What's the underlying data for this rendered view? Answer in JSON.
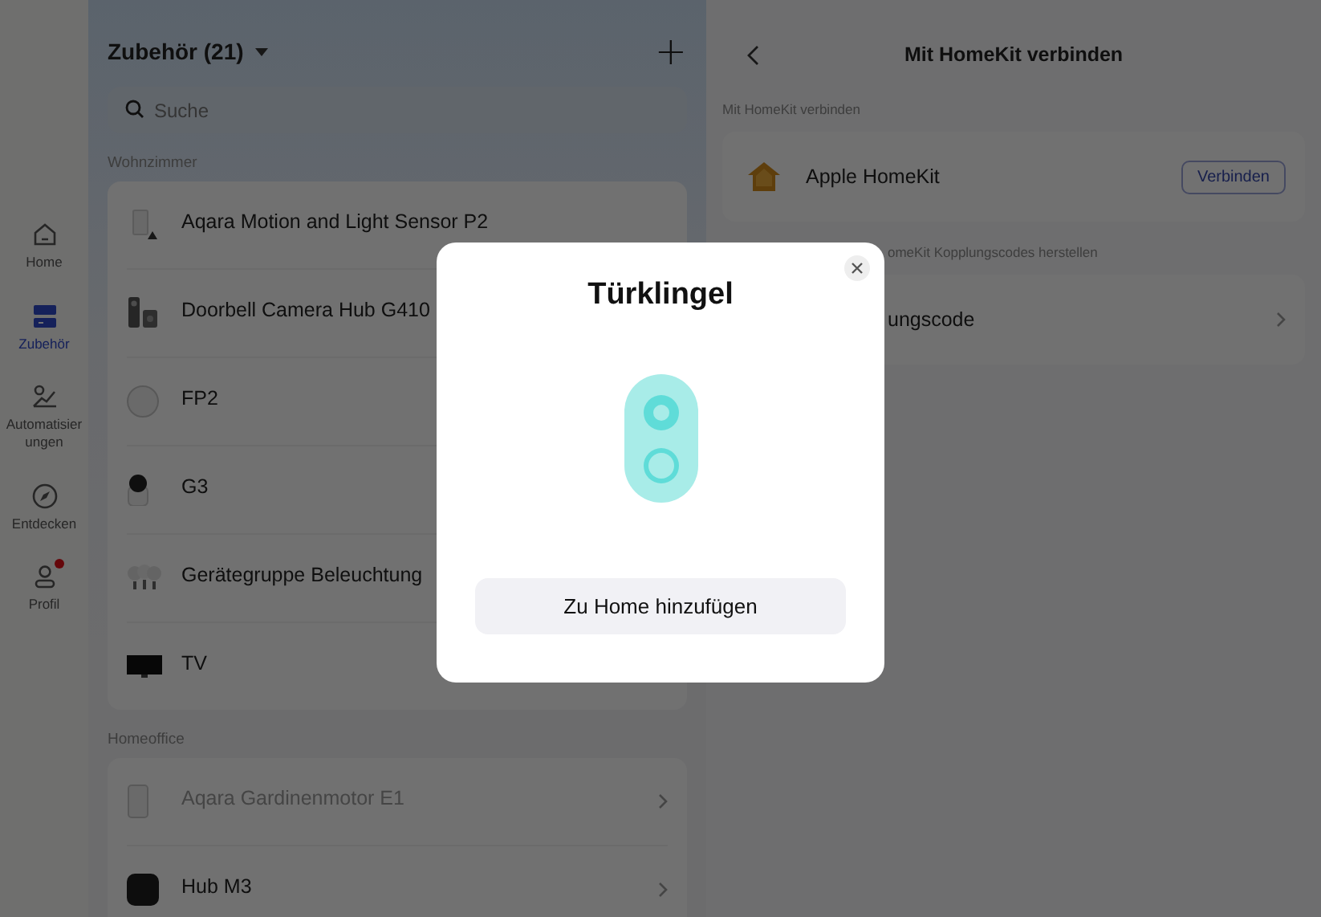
{
  "sidebar": {
    "items": [
      {
        "label": "Home",
        "kind": "home",
        "selected": false,
        "badge": false
      },
      {
        "label": "Zubehör",
        "kind": "cards",
        "selected": true,
        "badge": false
      },
      {
        "label": "Automatisier ungen",
        "kind": "automation",
        "selected": false,
        "badge": false
      },
      {
        "label": "Entdecken",
        "kind": "compass",
        "selected": false,
        "badge": false
      },
      {
        "label": "Profil",
        "kind": "profile",
        "selected": false,
        "badge": true
      }
    ]
  },
  "accessories": {
    "title": "Zubehör (21)",
    "add": "+",
    "search": {
      "placeholder": "Suche"
    },
    "rooms": [
      {
        "name": "Wohnzimmer",
        "devices": [
          {
            "name": "Aqara Motion and Light Sensor P2",
            "kind": "sensor",
            "offline": false,
            "chevron": false
          },
          {
            "name": "Doorbell Camera Hub G410",
            "kind": "doorbell",
            "offline": false,
            "chevron": false
          },
          {
            "name": "FP2",
            "kind": "disc",
            "offline": false,
            "chevron": false
          },
          {
            "name": "G3",
            "kind": "camera",
            "offline": false,
            "chevron": false
          },
          {
            "name": "Gerätegruppe Beleuchtung",
            "kind": "bulbs",
            "offline": false,
            "chevron": false
          },
          {
            "name": "TV",
            "kind": "tv",
            "offline": false,
            "chevron": false
          }
        ]
      },
      {
        "name": "Homeoffice",
        "devices": [
          {
            "name": "Aqara Gardinenmotor E1",
            "kind": "panel",
            "offline": true,
            "chevron": true
          },
          {
            "name": "Hub M3",
            "kind": "hub",
            "offline": false,
            "chevron": true
          }
        ]
      }
    ]
  },
  "homekit": {
    "title": "Mit HomeKit verbinden",
    "sections": [
      {
        "label": "Mit HomeKit verbinden",
        "kind": "connect",
        "row": {
          "name": "Apple HomeKit",
          "button": "Verbinden"
        }
      },
      {
        "label": "omeKit Kopplungscodes herstellen",
        "kind": "link",
        "row": {
          "name": "ungscode"
        }
      }
    ]
  },
  "dialog": {
    "title": "Türklingel",
    "button": "Zu Home hinzufügen"
  }
}
